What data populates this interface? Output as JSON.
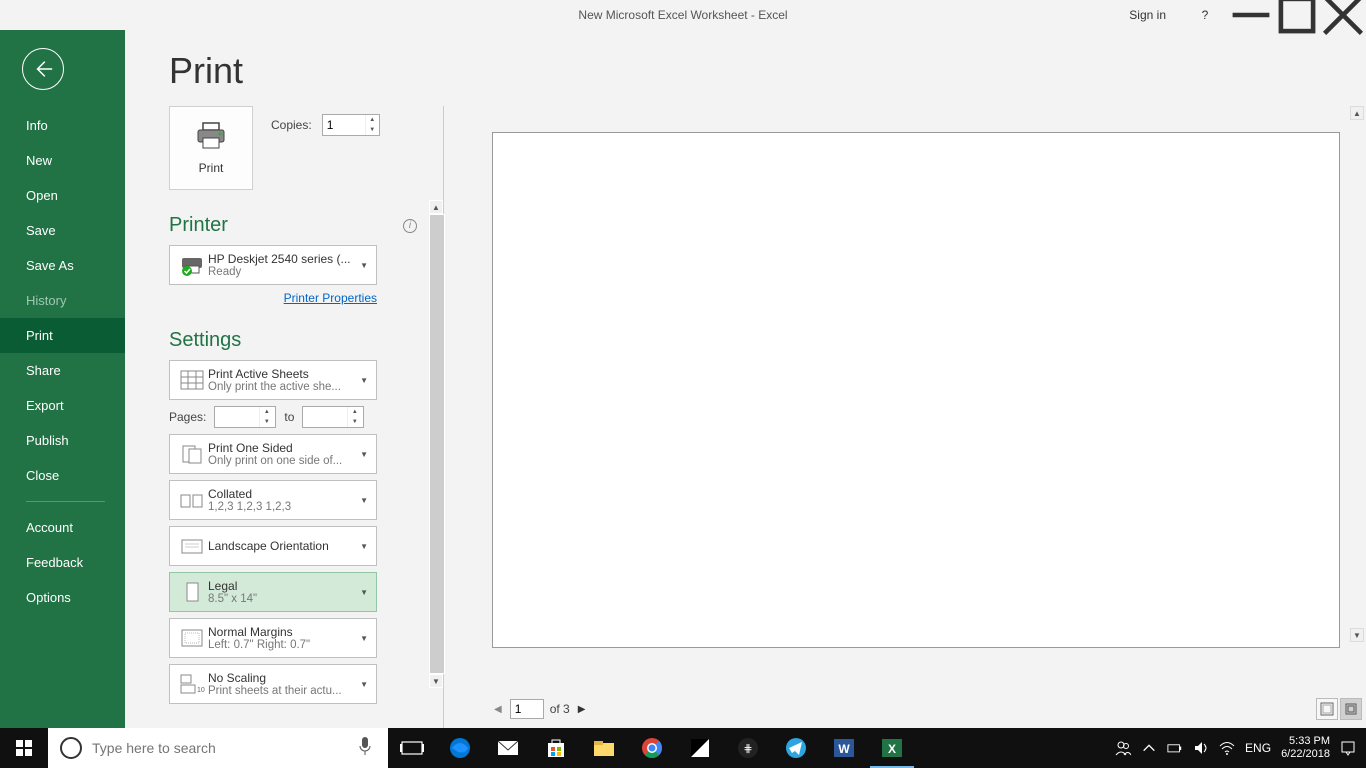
{
  "window": {
    "title": "New Microsoft Excel Worksheet  -  Excel",
    "signin": "Sign in"
  },
  "sidebar": {
    "items": [
      "Info",
      "New",
      "Open",
      "Save",
      "Save As",
      "History",
      "Print",
      "Share",
      "Export",
      "Publish",
      "Close"
    ],
    "bottom": [
      "Account",
      "Feedback",
      "Options"
    ],
    "active": "Print",
    "disabled": "History"
  },
  "page": {
    "title": "Print"
  },
  "print": {
    "button": "Print",
    "copies_label": "Copies:",
    "copies_value": "1"
  },
  "printer": {
    "section": "Printer",
    "name": "HP Deskjet 2540 series (...",
    "status": "Ready",
    "properties": "Printer Properties"
  },
  "settings": {
    "section": "Settings",
    "active_sheets": {
      "title": "Print Active Sheets",
      "sub": "Only print the active she..."
    },
    "pages_label": "Pages:",
    "pages_to": "to",
    "sided": {
      "title": "Print One Sided",
      "sub": "Only print on one side of..."
    },
    "collate": {
      "title": "Collated",
      "sub": "1,2,3    1,2,3    1,2,3"
    },
    "orientation": {
      "title": "Landscape Orientation"
    },
    "paper": {
      "title": "Legal",
      "sub": "8.5\" x 14\""
    },
    "margins": {
      "title": "Normal Margins",
      "sub": "Left:  0.7\"    Right:  0.7\""
    },
    "scaling": {
      "title": "No Scaling",
      "sub": "Print sheets at their actu..."
    }
  },
  "preview": {
    "page_current": "1",
    "page_of": "of 3"
  },
  "taskbar": {
    "search_placeholder": "Type here to search",
    "lang": "ENG",
    "time": "5:33 PM",
    "date": "6/22/2018"
  }
}
